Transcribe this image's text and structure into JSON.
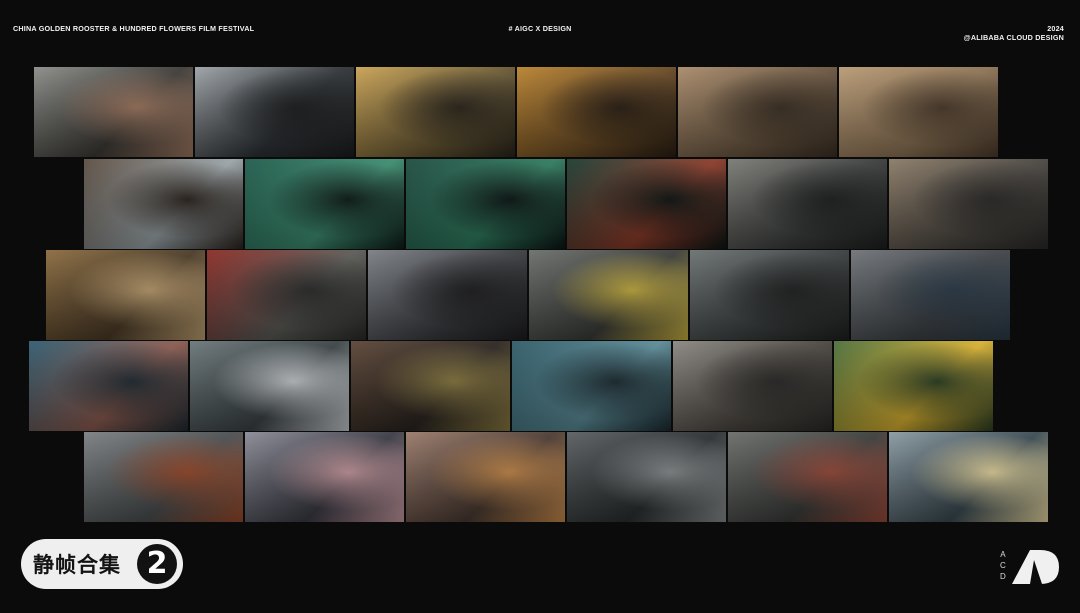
{
  "header": {
    "left": "CHINA GOLDEN ROOSTER & HUNDRED FLOWERS FILM FESTIVAL",
    "center": "# AIGC X DESIGN",
    "right_year": "2024",
    "right_credit": "@ALIBABA CLOUD DESIGN"
  },
  "badge": {
    "label": "静帧合集",
    "number": "2"
  },
  "logo": {
    "letters": [
      "A",
      "C",
      "D"
    ]
  },
  "colors": {
    "background": "#0b0b0b",
    "badge_bg": "#efefef",
    "text": "#f2f2f2"
  },
  "film_strips": [
    {
      "frames": [
        {
          "subject": "man-driving",
          "colors": [
            "#8a8c88",
            "#3c3a36",
            "#a07860"
          ]
        },
        {
          "subject": "steering-wheel",
          "colors": [
            "#9ca2a6",
            "#2e3236",
            "#1a1c1e"
          ]
        },
        {
          "subject": "jars-on-shelf",
          "colors": [
            "#c9a253",
            "#6a5a34",
            "#2a241a"
          ]
        },
        {
          "subject": "eye-through-slot",
          "colors": [
            "#b8822e",
            "#6a4a24",
            "#2a1e12"
          ]
        },
        {
          "subject": "cardboard-interior",
          "colors": [
            "#a88a6a",
            "#6a5640",
            "#3a2e22"
          ]
        },
        {
          "subject": "cardboard-flap",
          "colors": [
            "#b89a74",
            "#8c7254",
            "#4a3a2a"
          ]
        }
      ]
    },
    {
      "frames": [
        {
          "subject": "box-window",
          "colors": [
            "#5a4c40",
            "#9aa4a8",
            "#2a221c"
          ]
        },
        {
          "subject": "server-corridor",
          "colors": [
            "#1e5a4a",
            "#3c8c70",
            "#0c1a16"
          ]
        },
        {
          "subject": "server-corridor-lights",
          "colors": [
            "#1c4a3e",
            "#2e7a5e",
            "#0a1412"
          ]
        },
        {
          "subject": "server-rack-red",
          "colors": [
            "#1a3a30",
            "#8a3a28",
            "#0c1412"
          ]
        },
        {
          "subject": "cracked-phone",
          "colors": [
            "#7a7a74",
            "#3a3c3c",
            "#1c1e1e"
          ]
        },
        {
          "subject": "parcel-handoff",
          "colors": [
            "#8a7a66",
            "#4a4640",
            "#2a2826"
          ]
        }
      ]
    },
    {
      "frames": [
        {
          "subject": "box-in-shop",
          "colors": [
            "#8a6a3e",
            "#4a3a26",
            "#c0a070"
          ]
        },
        {
          "subject": "red-taxi-runner",
          "colors": [
            "#8a2a24",
            "#5a5a56",
            "#2a2a28"
          ]
        },
        {
          "subject": "woman-street",
          "colors": [
            "#7a7e84",
            "#3a3c40",
            "#1c1c1e"
          ]
        },
        {
          "subject": "woman-market",
          "colors": [
            "#6a6e6a",
            "#3a3c38",
            "#c8b040"
          ]
        },
        {
          "subject": "man-cap-shelves",
          "colors": [
            "#6a7070",
            "#3a3e3e",
            "#1e2020"
          ]
        },
        {
          "subject": "crowd-street",
          "colors": [
            "#6e7276",
            "#3e4246",
            "#2a3a48"
          ]
        }
      ]
    },
    {
      "frames": [
        {
          "subject": "aerial-crossing",
          "colors": [
            "#2e5a6e",
            "#8a5a4e",
            "#1e2a32"
          ]
        },
        {
          "subject": "chef-alley",
          "colors": [
            "#6a7678",
            "#3a4244",
            "#c8ccd0"
          ]
        },
        {
          "subject": "man-portrait",
          "colors": [
            "#5a4434",
            "#2a2420",
            "#8a7a40"
          ]
        },
        {
          "subject": "aerial-intersection",
          "colors": [
            "#2e5a66",
            "#5a8a96",
            "#1a2a30"
          ]
        },
        {
          "subject": "parcel-counter",
          "colors": [
            "#8a8680",
            "#4a4640",
            "#2a2826"
          ]
        },
        {
          "subject": "yellow-flowers-hand",
          "colors": [
            "#4a6e3a",
            "#d8b030",
            "#2a3e22"
          ]
        }
      ]
    },
    {
      "frames": [
        {
          "subject": "bus-street",
          "colors": [
            "#7a7e80",
            "#4a4e50",
            "#9a4a2a"
          ]
        },
        {
          "subject": "woman-city-night",
          "colors": [
            "#8a8a96",
            "#3a3a44",
            "#c89aa0"
          ]
        },
        {
          "subject": "man-patterned-shirt",
          "colors": [
            "#9a7a6a",
            "#4a3a32",
            "#c88a4a"
          ]
        },
        {
          "subject": "billboards-street",
          "colors": [
            "#5a5e60",
            "#2a2e30",
            "#8a8e90"
          ]
        },
        {
          "subject": "woman-running",
          "colors": [
            "#6a6c6a",
            "#3a3c3a",
            "#9a4a3a"
          ]
        },
        {
          "subject": "popcorn-machine",
          "colors": [
            "#8a9aa2",
            "#3a4a52",
            "#e8d8a0"
          ]
        }
      ]
    }
  ]
}
